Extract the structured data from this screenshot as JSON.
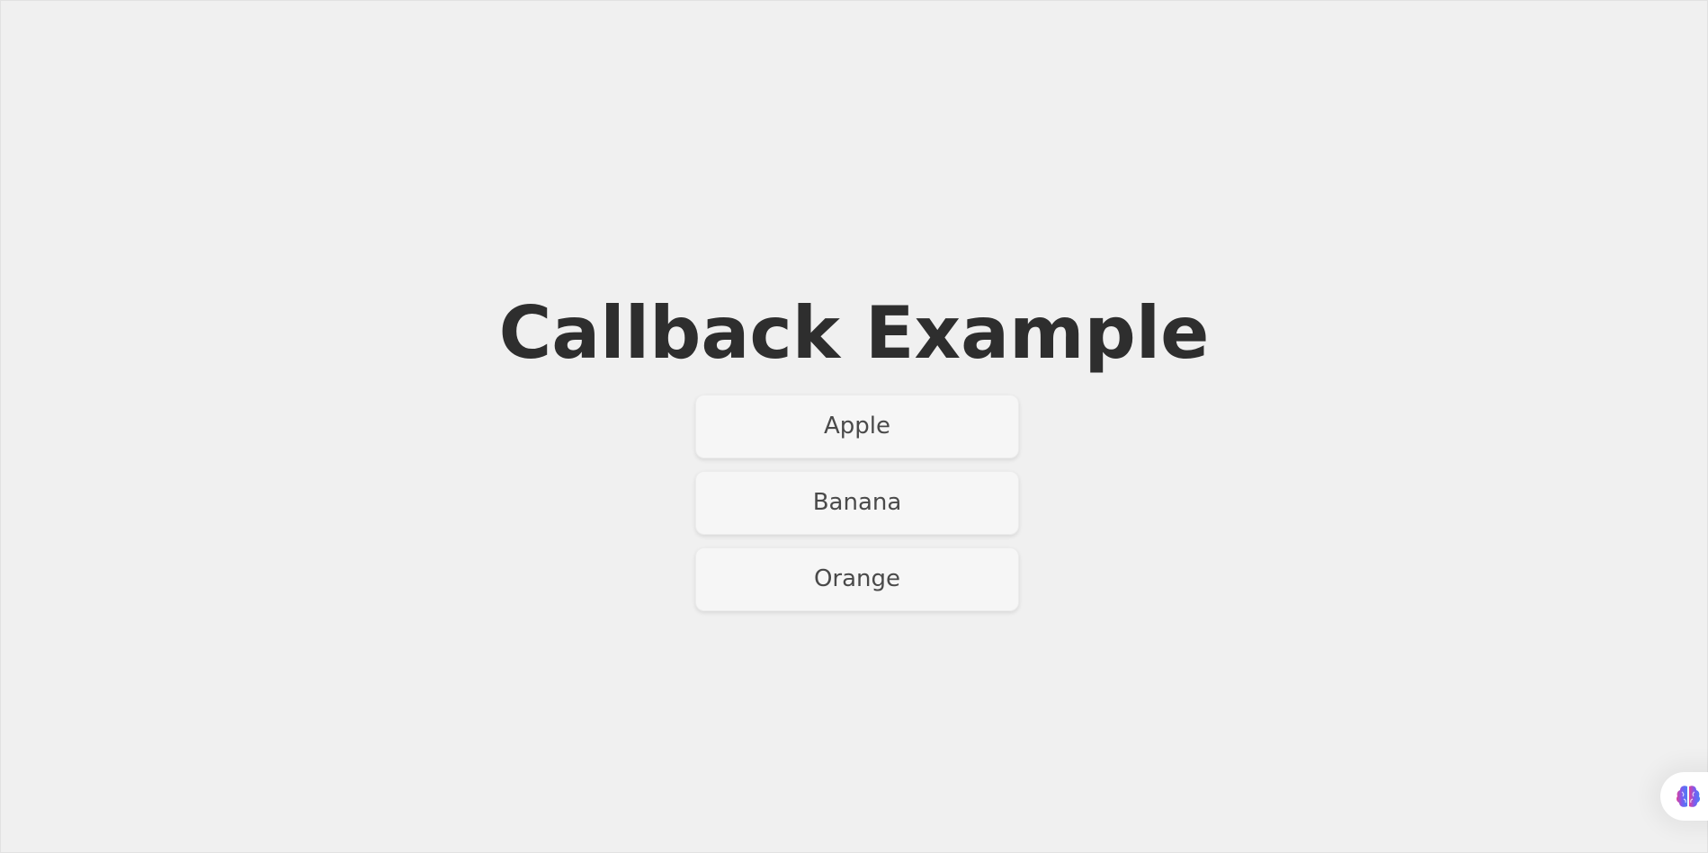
{
  "page": {
    "title": "Callback Example"
  },
  "fruits": {
    "items": [
      {
        "label": "Apple"
      },
      {
        "label": "Banana"
      },
      {
        "label": "Orange"
      }
    ]
  },
  "widget": {
    "icon": "brain-icon",
    "colors": [
      "#e0409a",
      "#7b5cf0",
      "#4a7ff5"
    ]
  },
  "colors": {
    "background": "#f0f0f0",
    "title": "#2e2e2e",
    "button_background": "#f6f6f6",
    "button_text": "#4a4a4a"
  }
}
